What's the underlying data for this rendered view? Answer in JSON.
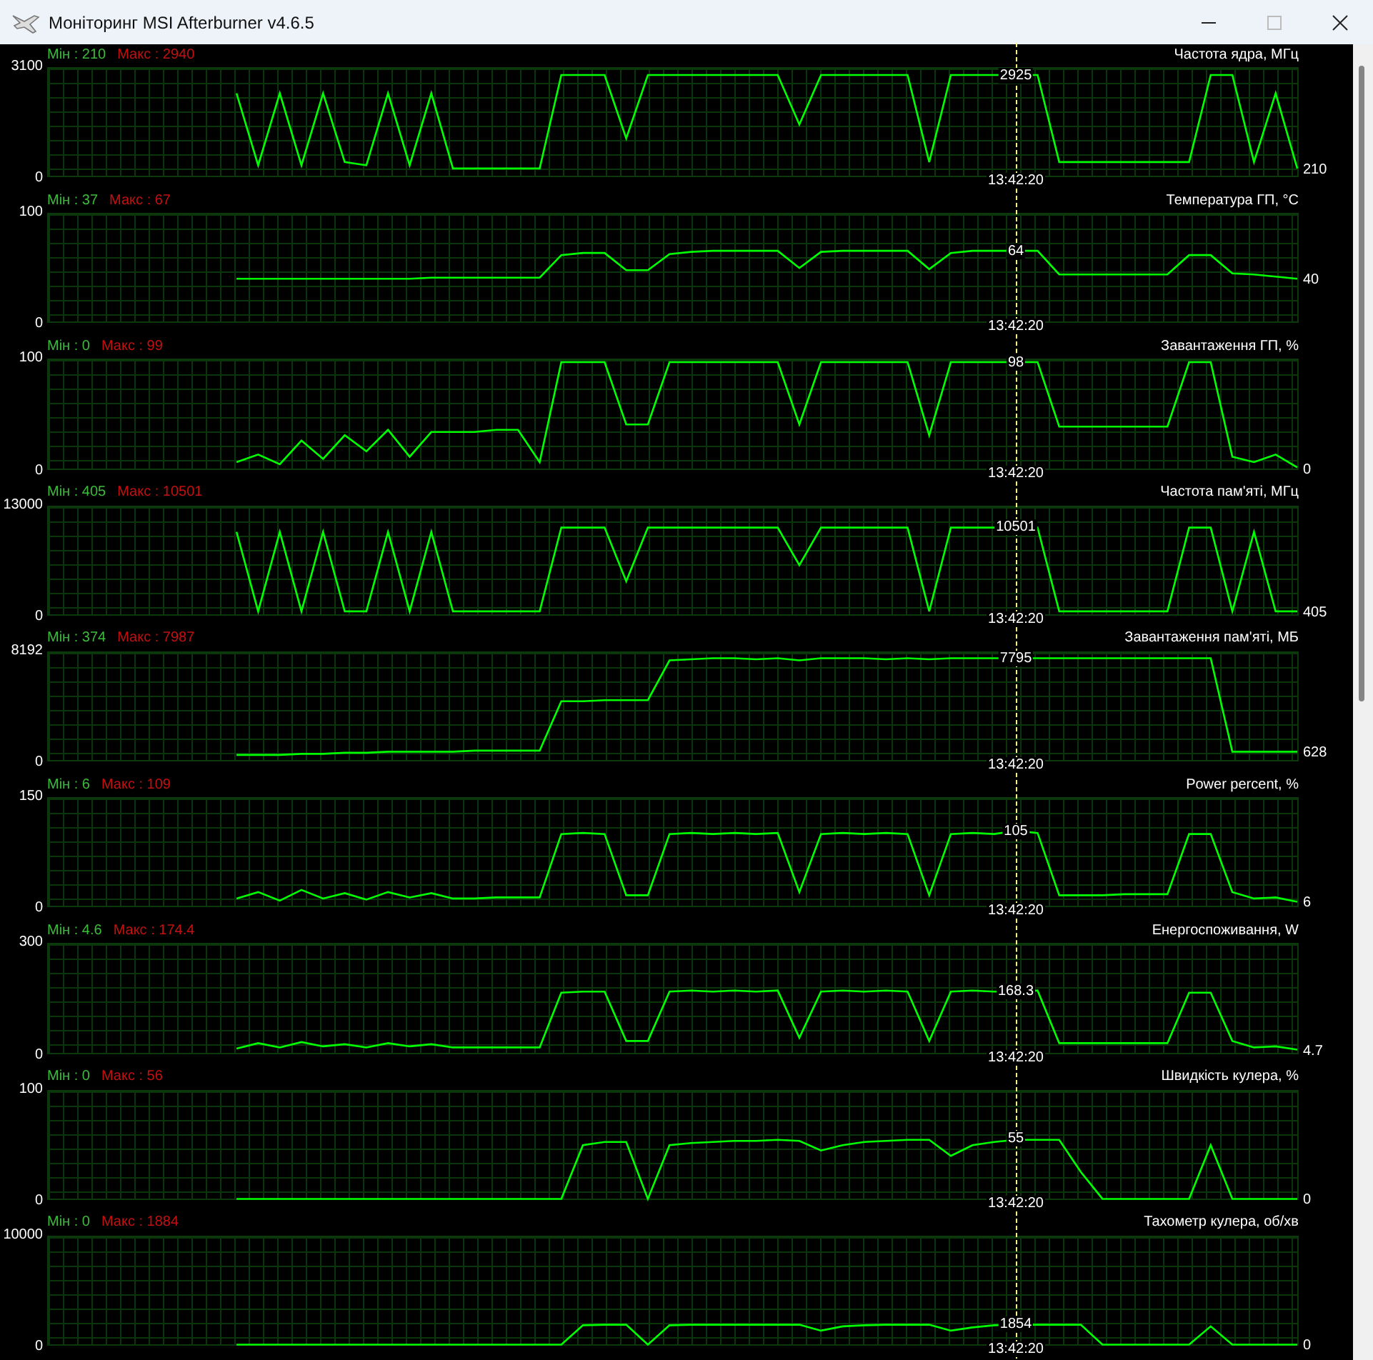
{
  "window": {
    "title": "Моніторинг MSI Afterburner v4.6.5"
  },
  "graphs": [
    {
      "min_label": "Мін : 210",
      "max_label": "Макс : 2940",
      "title": "Частота ядра, МГц",
      "y_top_label": "3100",
      "y_bottom_label": "0",
      "cursor_value": "2925",
      "cursor_time": "13:42:20",
      "current_value": "210"
    },
    {
      "min_label": "Мін : 37",
      "max_label": "Макс : 67",
      "title": "Температура ГП, °C",
      "y_top_label": "100",
      "y_bottom_label": "0",
      "cursor_value": "64",
      "cursor_time": "13:42:20",
      "current_value": "40"
    },
    {
      "min_label": "Мін : 0",
      "max_label": "Макс : 99",
      "title": "Завантаження ГП, %",
      "y_top_label": "100",
      "y_bottom_label": "0",
      "cursor_value": "98",
      "cursor_time": "13:42:20",
      "current_value": "0"
    },
    {
      "min_label": "Мін : 405",
      "max_label": "Макс : 10501",
      "title": "Частота пам'яті, МГц",
      "y_top_label": "13000",
      "y_bottom_label": "0",
      "cursor_value": "10501",
      "cursor_time": "13:42:20",
      "current_value": "405"
    },
    {
      "min_label": "Мін : 374",
      "max_label": "Макс : 7987",
      "title": "Завантаження пам'яті, МБ",
      "y_top_label": "8192",
      "y_bottom_label": "0",
      "cursor_value": "7795",
      "cursor_time": "13:42:20",
      "current_value": "628"
    },
    {
      "min_label": "Мін : 6",
      "max_label": "Макс : 109",
      "title": "Power percent, %",
      "y_top_label": "150",
      "y_bottom_label": "0",
      "cursor_value": "105",
      "cursor_time": "13:42:20",
      "current_value": "6"
    },
    {
      "min_label": "Мін : 4.6",
      "max_label": "Макс : 174.4",
      "title": "Енергоспоживання, W",
      "y_top_label": "300",
      "y_bottom_label": "0",
      "cursor_value": "168.3",
      "cursor_time": "13:42:20",
      "current_value": "4.7"
    },
    {
      "min_label": "Мін : 0",
      "max_label": "Макс : 56",
      "title": "Швидкість кулера, %",
      "y_top_label": "100",
      "y_bottom_label": "0",
      "cursor_value": "55",
      "cursor_time": "13:42:20",
      "current_value": "0"
    },
    {
      "min_label": "Мін : 0",
      "max_label": "Макс : 1884",
      "title": "Тахометр кулера, об/хв",
      "y_top_label": "10000",
      "y_bottom_label": "0",
      "cursor_value": "1854",
      "cursor_time": "13:42:20",
      "current_value": "0"
    }
  ]
}
